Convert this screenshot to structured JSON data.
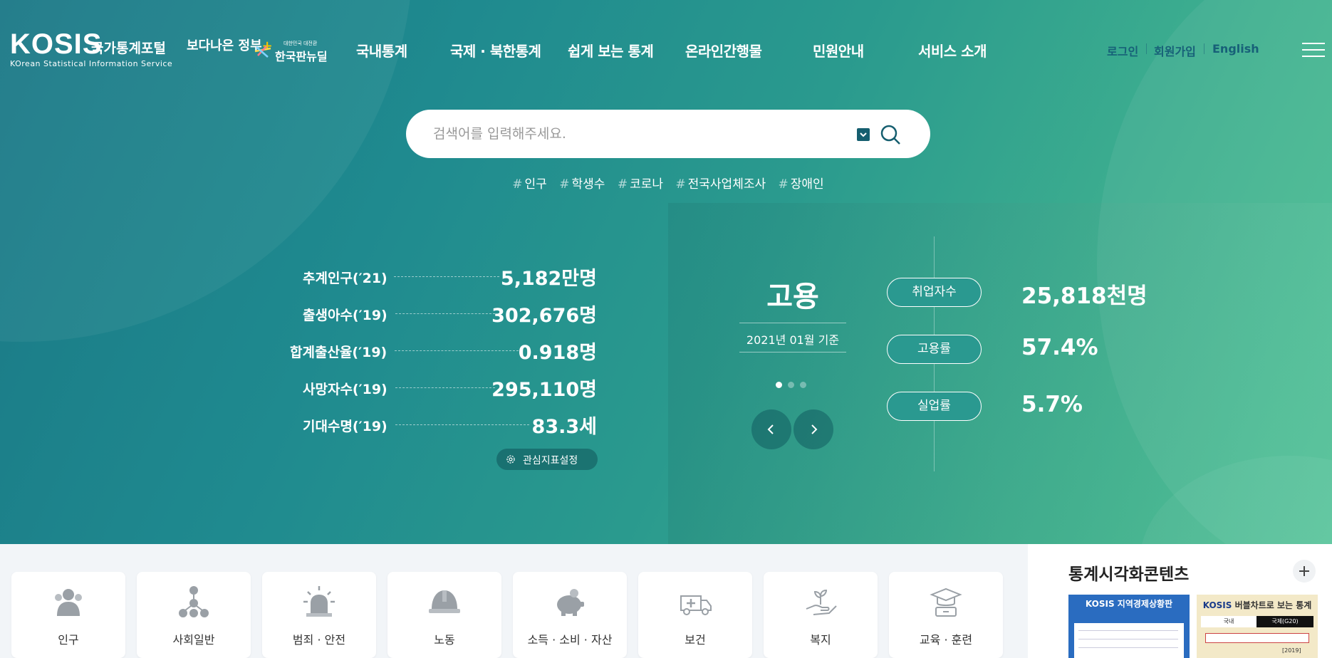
{
  "header": {
    "logo_main": "KOSIS",
    "logo_sub": "KOrean Statistical Information Service",
    "logo_kr": "국가통계포털",
    "gov_slogan_1": "보다나은 정부",
    "gov_slogan_2_small": "대한민국 대전환",
    "gov_slogan_2": "한국판뉴딜",
    "nav": [
      "국내통계",
      "국제 · 북한통계",
      "쉽게 보는 통계",
      "온라인간행물",
      "민원안내",
      "서비스 소개"
    ],
    "util": {
      "login": "로그인",
      "signup": "회원가입",
      "english": "English"
    }
  },
  "search": {
    "placeholder": "검색어를 입력해주세요.",
    "value": "",
    "tags": [
      "인구",
      "학생수",
      "코로나",
      "전국사업체조사",
      "장애인"
    ]
  },
  "stats": [
    {
      "label": "추계인구(′21)",
      "value": "5,182만명"
    },
    {
      "label": "출생아수(′19)",
      "value": "302,676명"
    },
    {
      "label": "합계출산율(′19)",
      "value": "0.918명"
    },
    {
      "label": "사망자수(′19)",
      "value": "295,110명"
    },
    {
      "label": "기대수명(′19)",
      "value": "83.3세"
    }
  ],
  "interest_button": "관심지표설정",
  "employment": {
    "title": "고용",
    "date": "2021년 01월 기준",
    "slides_total": 3,
    "slide_active": 1,
    "indicators": [
      {
        "label": "취업자수",
        "value": "25,818천명"
      },
      {
        "label": "고용률",
        "value": "57.4%"
      },
      {
        "label": "실업률",
        "value": "5.7%"
      }
    ]
  },
  "categories": [
    {
      "label": "인구",
      "icon": "people-icon"
    },
    {
      "label": "사회일반",
      "icon": "network-icon"
    },
    {
      "label": "범죄 · 안전",
      "icon": "siren-icon"
    },
    {
      "label": "노동",
      "icon": "helmet-icon"
    },
    {
      "label": "소득 · 소비 · 자산",
      "icon": "piggy-bank-icon"
    },
    {
      "label": "보건",
      "icon": "ambulance-icon"
    },
    {
      "label": "복지",
      "icon": "hand-plant-icon"
    },
    {
      "label": "교육 · 훈련",
      "icon": "graduation-icon"
    }
  ],
  "viz": {
    "title": "통계시각화콘텐츠",
    "thumb1_title": "KOSIS 지역경제상황판",
    "thumb2_title_a": "KOSIS",
    "thumb2_title_b": "버블차트로 보는 통계",
    "thumb2_tab1": "국내",
    "thumb2_tab2": "국제(G20)",
    "thumb2_year": "[2019]"
  },
  "colors": {
    "hero_start": "#1a7886",
    "hero_end": "#4cc093",
    "util_text": "#176078",
    "dropdown": "#155e6f"
  }
}
